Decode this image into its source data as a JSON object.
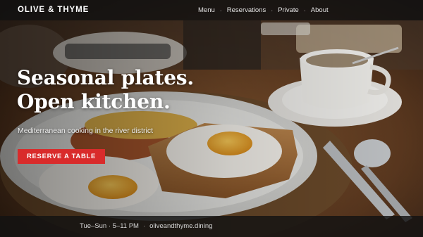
{
  "brand": {
    "name": "OLIVE & THYME"
  },
  "nav": {
    "links": [
      "Menu",
      "Reservations",
      "Private",
      "About"
    ],
    "separator": "·"
  },
  "hero": {
    "headline_line1": "Seasonal plates.",
    "headline_line2": "Open kitchen.",
    "subtext": "Mediterranean cooking in the river district",
    "cta_label": "RESERVE A TABLE"
  },
  "footer": {
    "hours": "Tue–Sun · 5–11 PM",
    "separator": "·",
    "site": "oliveandthyme.dining"
  },
  "colors": {
    "accent": "#d92b2b",
    "nav_bg": "#121212",
    "text": "#ffffff"
  }
}
